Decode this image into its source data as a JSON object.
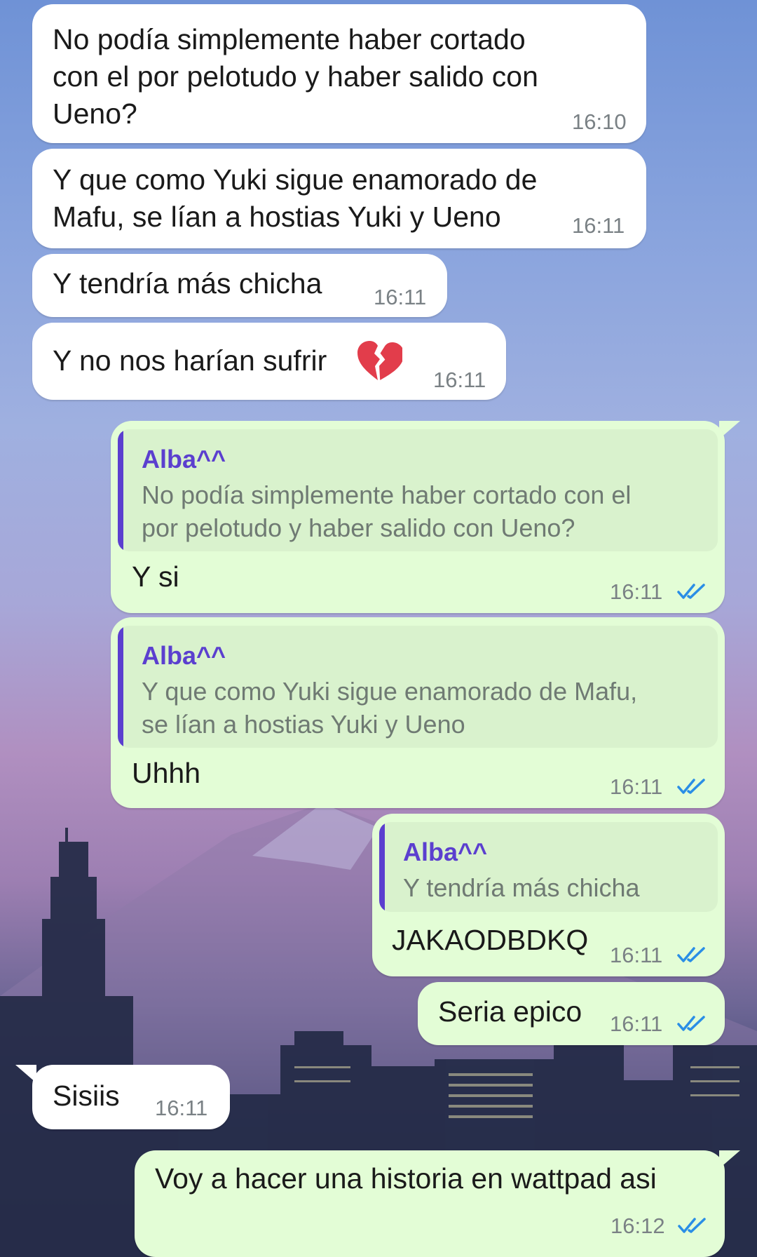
{
  "colors": {
    "incoming_bubble": "#ffffff",
    "outgoing_bubble": "#e3fdd6",
    "quote_accent": "#5b3fcf",
    "read_ticks": "#2a8ee6",
    "timestamp": "#7a8185"
  },
  "messages": [
    {
      "direction": "incoming",
      "lines": [
        "No podía simplemente haber cortado",
        "con el por pelotudo y haber salido con",
        "Ueno?"
      ],
      "time": "16:10"
    },
    {
      "direction": "incoming",
      "lines": [
        "Y que como Yuki sigue enamorado de",
        "Mafu, se lían a hostias Yuki y Ueno"
      ],
      "time": "16:11"
    },
    {
      "direction": "incoming",
      "lines": [
        "Y tendría más chicha"
      ],
      "time": "16:11"
    },
    {
      "direction": "incoming",
      "lines": [
        "Y no nos harían sufrir"
      ],
      "emoji": "broken-heart-icon",
      "time": "16:11"
    },
    {
      "direction": "outgoing",
      "reply_to": {
        "author": "Alba^^",
        "lines": [
          "No podía simplemente haber cortado con el",
          "por pelotudo y haber salido con Ueno?"
        ]
      },
      "lines": [
        "Y si"
      ],
      "time": "16:11",
      "status": "read-ticks-icon"
    },
    {
      "direction": "outgoing",
      "reply_to": {
        "author": "Alba^^",
        "lines": [
          "Y que como Yuki sigue enamorado de Mafu,",
          "se lían a hostias Yuki y Ueno"
        ]
      },
      "lines": [
        "Uhhh"
      ],
      "time": "16:11",
      "status": "read-ticks-icon"
    },
    {
      "direction": "outgoing",
      "reply_to": {
        "author": "Alba^^",
        "lines": [
          "Y tendría más chicha"
        ]
      },
      "lines": [
        "JAKAODBDKQ"
      ],
      "time": "16:11",
      "status": "read-ticks-icon"
    },
    {
      "direction": "outgoing",
      "lines": [
        "Seria epico"
      ],
      "time": "16:11",
      "status": "read-ticks-icon"
    },
    {
      "direction": "incoming",
      "lines": [
        "Sisiis"
      ],
      "time": "16:11"
    },
    {
      "direction": "outgoing",
      "lines": [
        "Voy a hacer una historia en wattpad asi"
      ],
      "time": "16:12",
      "status": "read-ticks-icon"
    }
  ]
}
